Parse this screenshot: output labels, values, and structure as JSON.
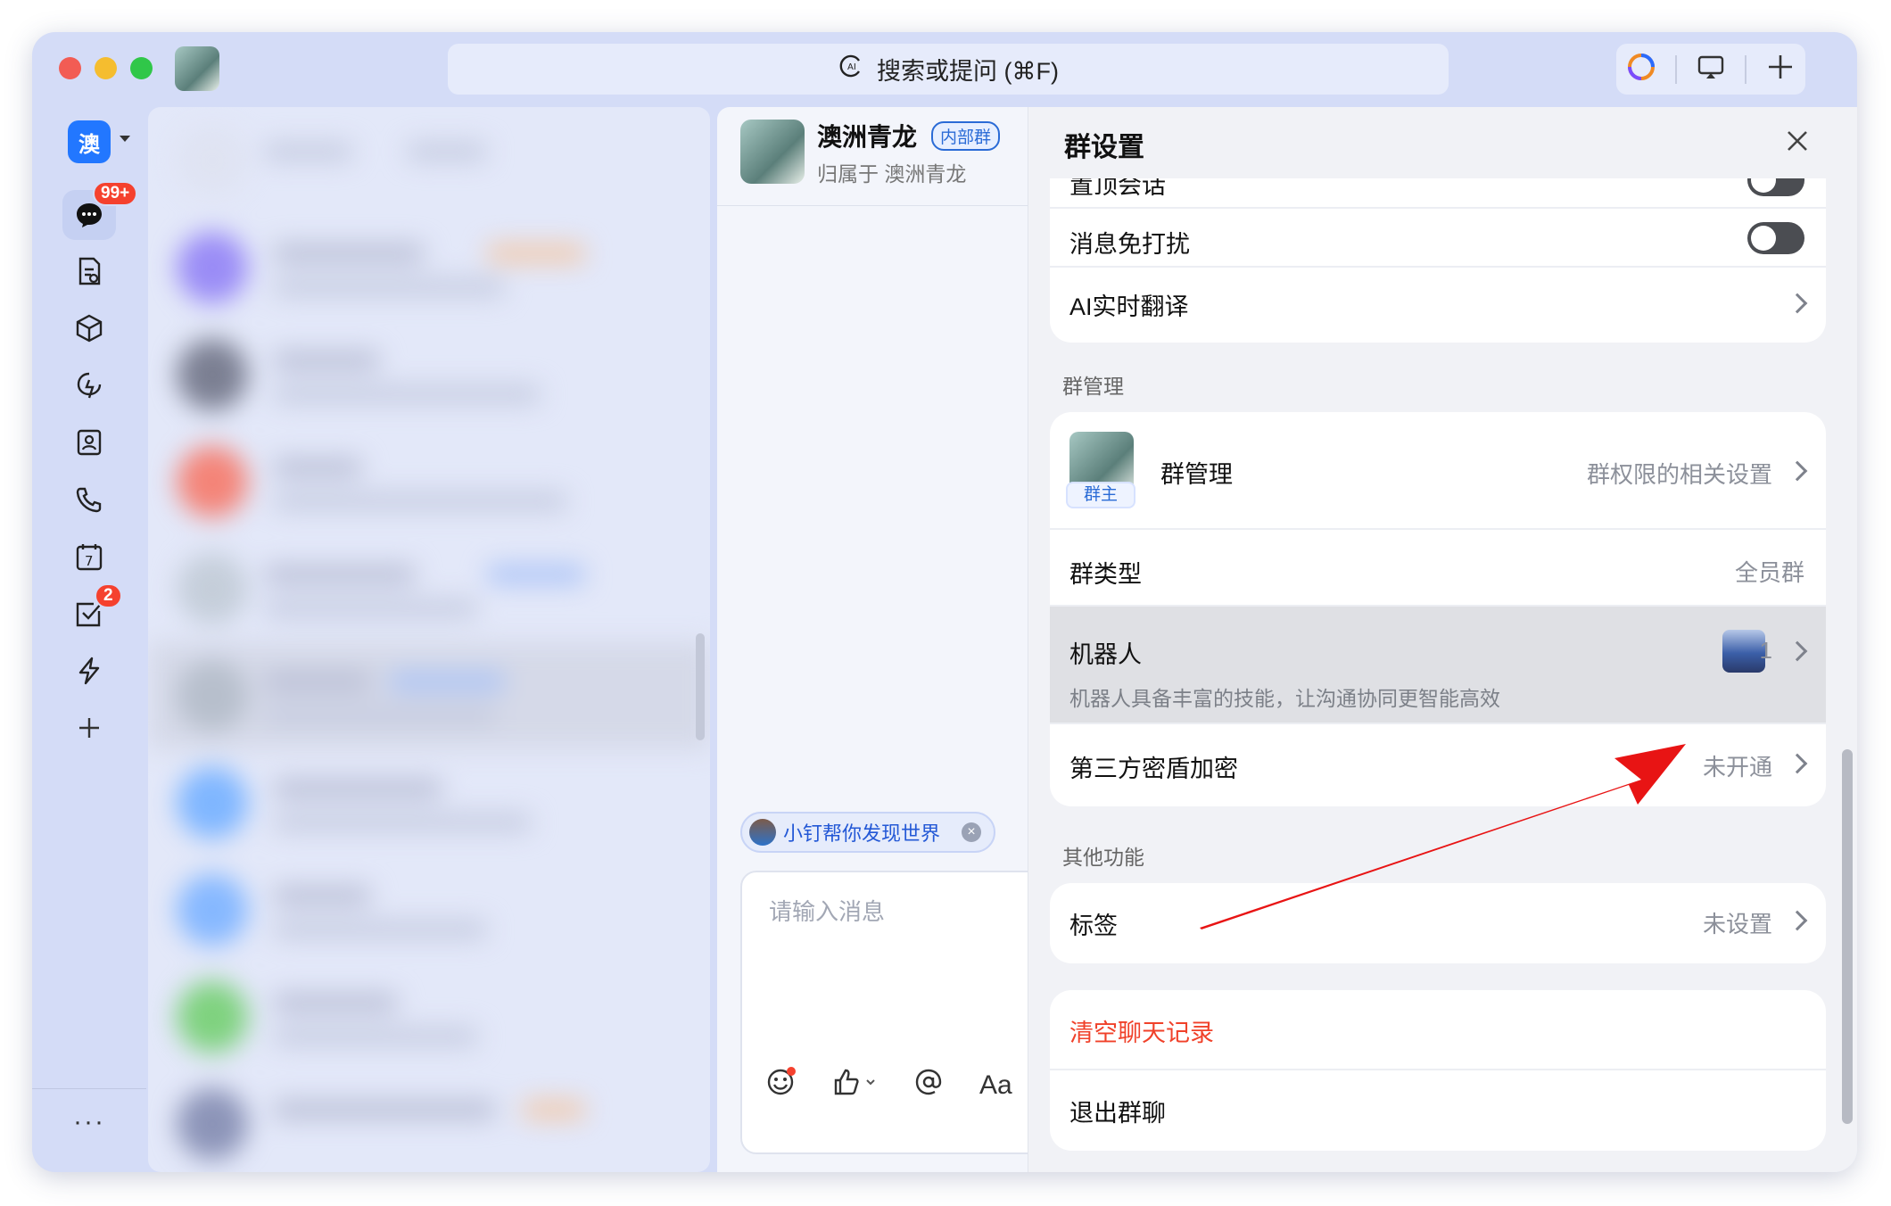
{
  "titlebar": {
    "search_text": "搜索或提问 (⌘F)"
  },
  "rail": {
    "org_label": "澳",
    "messages_badge": "99+",
    "todo_badge": "2",
    "more_label": "···"
  },
  "chat": {
    "title": "澳洲青龙",
    "tag": "内部群",
    "subtitle": "归属于 澳洲青龙",
    "assistant_pill": "小钉帮你发现世界",
    "input_placeholder": "请输入消息",
    "font_button": "Aa"
  },
  "settings": {
    "title": "群设置",
    "rows_top": [
      {
        "label": "置顶会话",
        "toggle": false
      },
      {
        "label": "消息免打扰",
        "toggle": false
      },
      {
        "label": "AI实时翻译"
      }
    ],
    "section_manage": "群管理",
    "manage_card": {
      "group_manage_label": "群管理",
      "group_manage_value": "群权限的相关设置",
      "owner_badge": "群主",
      "group_type_label": "群类型",
      "group_type_value": "全员群",
      "robot_label": "机器人",
      "robot_count": "1",
      "robot_desc": "机器人具备丰富的技能，让沟通协同更智能高效",
      "encrypt_label": "第三方密盾加密",
      "encrypt_value": "未开通"
    },
    "section_other": "其他功能",
    "tag_label": "标签",
    "tag_value": "未设置",
    "clear_history": "清空聊天记录",
    "leave_group": "退出群聊"
  },
  "colors": {
    "accent": "#2277ff",
    "danger": "#f5412e",
    "annotation_arrow": "#e81414"
  }
}
